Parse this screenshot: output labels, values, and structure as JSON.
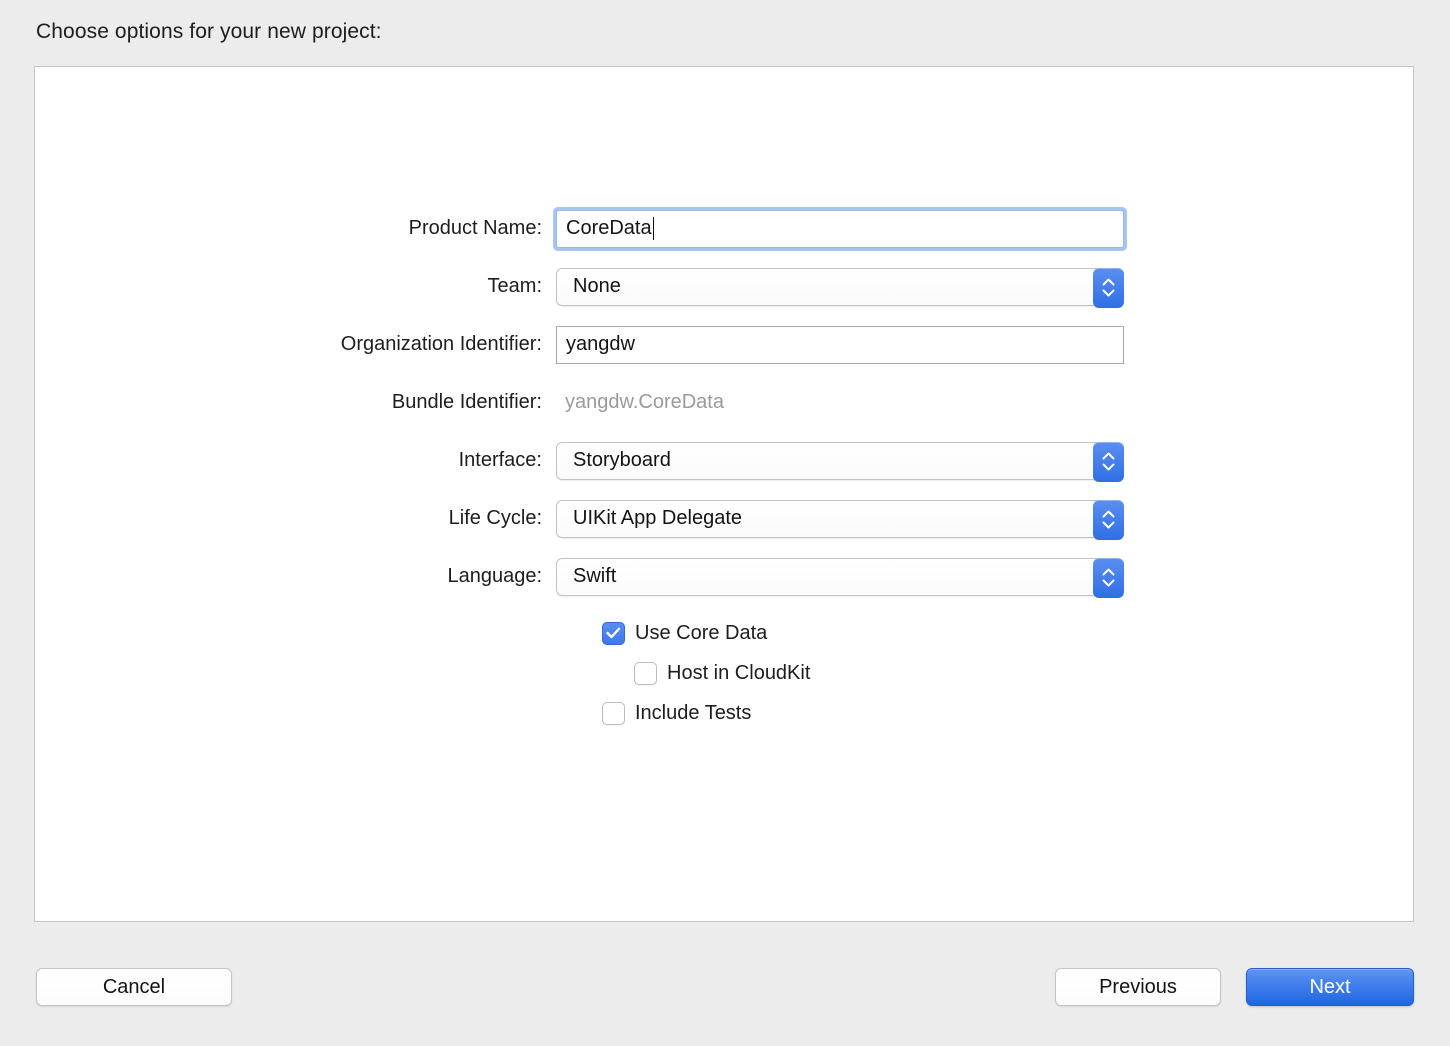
{
  "dialog": {
    "title": "Choose options for your new project:"
  },
  "form": {
    "rows": [
      {
        "label": "Product Name:",
        "value": "CoreData",
        "type": "textfield-focused"
      },
      {
        "label": "Team:",
        "value": "None",
        "type": "popup"
      },
      {
        "label": "Organization Identifier:",
        "value": "yangdw",
        "type": "textfield"
      },
      {
        "label": "Bundle Identifier:",
        "value": "yangdw.CoreData",
        "type": "static"
      },
      {
        "label": "Interface:",
        "value": "Storyboard",
        "type": "popup"
      },
      {
        "label": "Life Cycle:",
        "value": "UIKit App Delegate",
        "type": "popup"
      },
      {
        "label": "Language:",
        "value": "Swift",
        "type": "popup"
      }
    ],
    "checkboxes": [
      {
        "label": "Use Core Data",
        "checked": true,
        "indented": false
      },
      {
        "label": "Host in CloudKit",
        "checked": false,
        "indented": true
      },
      {
        "label": "Include Tests",
        "checked": false,
        "indented": false
      }
    ]
  },
  "footer": {
    "cancel_label": "Cancel",
    "previous_label": "Previous",
    "next_label": "Next"
  },
  "colors": {
    "accent_blue": "#3c78ee",
    "default_button_blue": "#2066e2",
    "focus_ring": "#a8c4f0",
    "window_background": "#ececec",
    "panel_background": "#ffffff",
    "disabled_text": "#9a9a9a"
  }
}
